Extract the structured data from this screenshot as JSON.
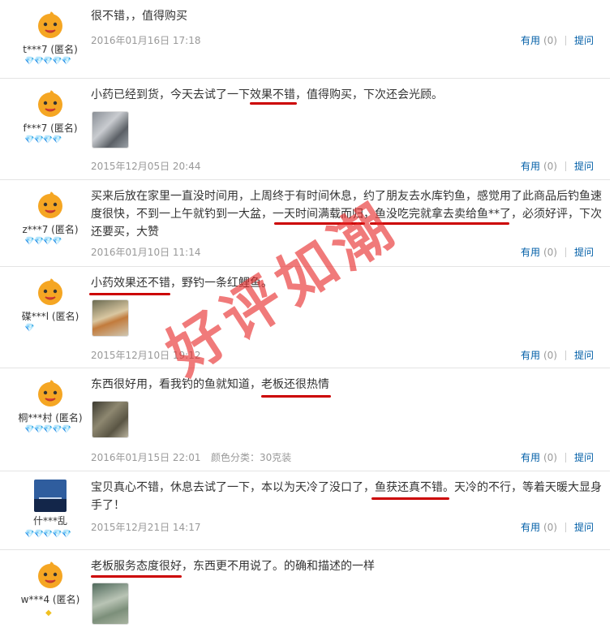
{
  "watermark": "好评如潮",
  "useful_label": "有用",
  "ask_label": "提问",
  "reviews": [
    {
      "user": "t***7 (匿名)",
      "hearts": "💎💎💎💎💎",
      "content": "很不错，，值得购买",
      "date": "2016年01月16日 17:18",
      "extra": "",
      "useful": "(0)"
    },
    {
      "user": "f***7 (匿名)",
      "hearts": "💎💎💎💎",
      "content": "小药已经到货，今天去试了一下效果不错，值得购买，下次还会光顾。",
      "date": "2015年12月05日 20:44",
      "extra": "",
      "useful": "(0)"
    },
    {
      "user": "z***7 (匿名)",
      "hearts": "💎💎💎💎",
      "content": "买来后放在家里一直没时间用，上周终于有时间休息，约了朋友去水库钓鱼，感觉用了此商品后钓鱼速度很快，不到一上午就钓到一大盆，一天时间满载而归，鱼没吃完就拿去卖给鱼**了，必须好评，下次还要买，大赞",
      "date": "2016年01月10日 11:14",
      "extra": "",
      "useful": "(0)"
    },
    {
      "user": "碟***l (匿名)",
      "hearts": "💎",
      "content": "小药效果还不错，野钓一条红鲤鱼。",
      "date": "2015年12月10日 19:12",
      "extra": "",
      "useful": "(0)"
    },
    {
      "user": "桐***村 (匿名)",
      "hearts": "💎💎💎💎💎",
      "content": "东西很好用，看我钓的鱼就知道，老板还很热情",
      "date": "2016年01月15日 22:01",
      "extra": "颜色分类：30克装",
      "useful": "(0)"
    },
    {
      "user": "什***乱",
      "hearts": "💎💎💎💎💎",
      "content": "宝贝真心不错，休息去试了一下，本以为天冷了没口了，鱼获还真不错。天冷的不行，等着天暖大显身手了！",
      "date": "2015年12月21日 14:17",
      "extra": "",
      "useful": "(0)"
    },
    {
      "user": "w***4 (匿名)",
      "hearts": "◆",
      "content": "老板服务态度很好，东西更不用说了。的确和描述的一样",
      "date": "",
      "extra": "",
      "useful": ""
    }
  ]
}
